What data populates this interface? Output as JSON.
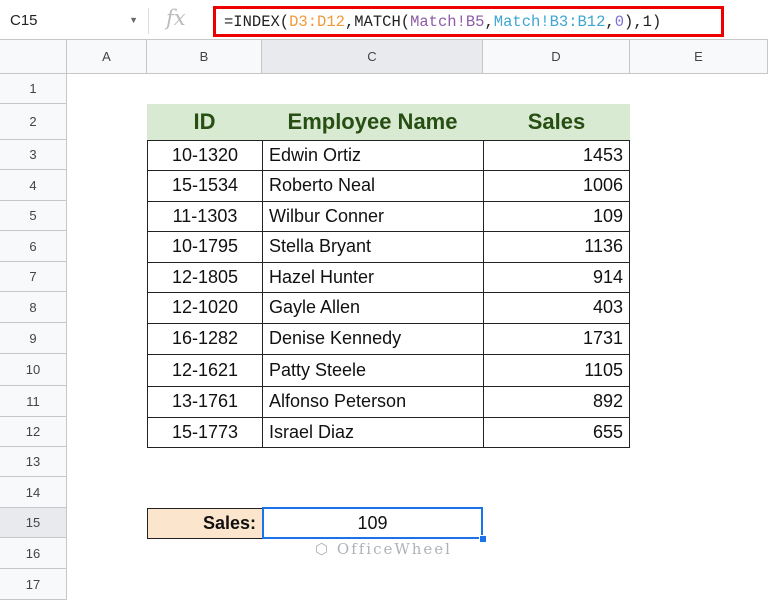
{
  "name_box": "C15",
  "fx_label": "fx",
  "formula": {
    "parts": [
      {
        "text": "=INDEX(",
        "color": "#222222"
      },
      {
        "text": "D3:D12",
        "color": "#f09a3a"
      },
      {
        "text": ",MATCH(",
        "color": "#222222"
      },
      {
        "text": "Match!B5",
        "color": "#8e5ba8"
      },
      {
        "text": ",",
        "color": "#222222"
      },
      {
        "text": "Match!B3:B12",
        "color": "#3ea6d3"
      },
      {
        "text": ",",
        "color": "#222222"
      },
      {
        "text": "0",
        "color": "#7b6fd8"
      },
      {
        "text": "),1)",
        "color": "#222222"
      }
    ]
  },
  "columns": [
    "A",
    "B",
    "C",
    "D",
    "E"
  ],
  "rows": [
    "1",
    "2",
    "3",
    "4",
    "5",
    "6",
    "7",
    "8",
    "9",
    "10",
    "11",
    "12",
    "13",
    "14",
    "15",
    "16",
    "17"
  ],
  "table": {
    "headers": [
      "ID",
      "Employee Name",
      "Sales"
    ],
    "rows": [
      [
        "10-1320",
        "Edwin Ortiz",
        "1453"
      ],
      [
        "15-1534",
        "Roberto Neal",
        "1006"
      ],
      [
        "11-1303",
        "Wilbur Conner",
        "109"
      ],
      [
        "10-1795",
        "Stella Bryant",
        "1136"
      ],
      [
        "12-1805",
        "Hazel Hunter",
        "914"
      ],
      [
        "12-1020",
        "Gayle Allen",
        "403"
      ],
      [
        "16-1282",
        "Denise Kennedy",
        "1731"
      ],
      [
        "12-1621",
        "Patty Steele",
        "1105"
      ],
      [
        "13-1761",
        "Alfonso Peterson",
        "892"
      ],
      [
        "15-1773",
        "Israel Diaz",
        "655"
      ]
    ]
  },
  "result": {
    "label": "Sales:",
    "value": "109"
  },
  "watermark": "OfficeWheel",
  "colors": {
    "header_fill": "#d9ead3",
    "label_fill": "#fce5cd",
    "selection": "#1a73e8",
    "formula_border": "#e00000"
  }
}
